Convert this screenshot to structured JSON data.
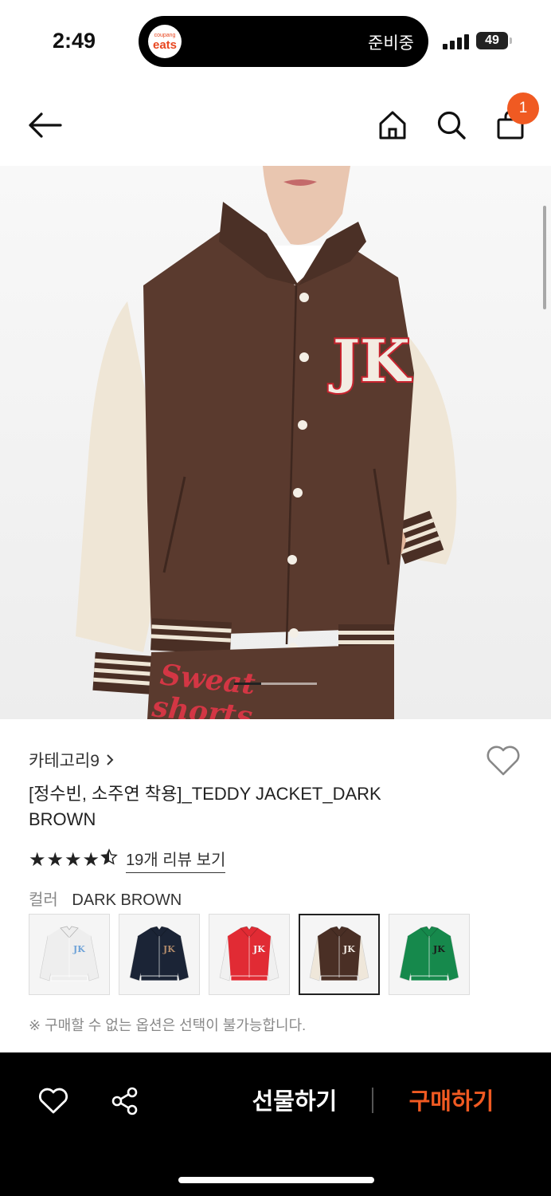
{
  "status_bar": {
    "time": "2:49",
    "island_app_small": "coupang",
    "island_app_big": "eats",
    "island_status": "준비중",
    "battery": "49"
  },
  "header": {
    "cart_count": "1"
  },
  "product": {
    "category": "카테고리9",
    "title": "[정수빈, 소주연 착용]_TEDDY JACKET_DARK BROWN",
    "rating_stars": 4.5,
    "reviews_link": "19개 리뷰 보기",
    "color_label": "컬러",
    "color_value": "DARK BROWN",
    "swatches": [
      {
        "body": "#eeeeee",
        "sleeve": "#eeeeee",
        "logo": "#6fa3d8"
      },
      {
        "body": "#1b2436",
        "sleeve": "#1b2436",
        "logo": "#b08a6a"
      },
      {
        "body": "#e12b34",
        "sleeve": "#f0f0f0",
        "logo": "#f5f5f5"
      },
      {
        "body": "#4a2f25",
        "sleeve": "#efe7da",
        "logo": "#f0e8e0"
      },
      {
        "body": "#16894c",
        "sleeve": "#16894c",
        "logo": "#1a1a1a"
      }
    ],
    "selected_swatch": 3,
    "notice": "※ 구매할 수 없는 옵션은 선택이 불가능합니다.",
    "image_pager": {
      "current": 1,
      "total": 3
    }
  },
  "bottom_bar": {
    "gift_label": "선물하기",
    "buy_label": "구매하기"
  },
  "colors": {
    "accent": "#f05a22",
    "jacket_body": "#5a3a2e",
    "jacket_sleeve": "#efe6d6",
    "logo_red": "#c8242f"
  }
}
